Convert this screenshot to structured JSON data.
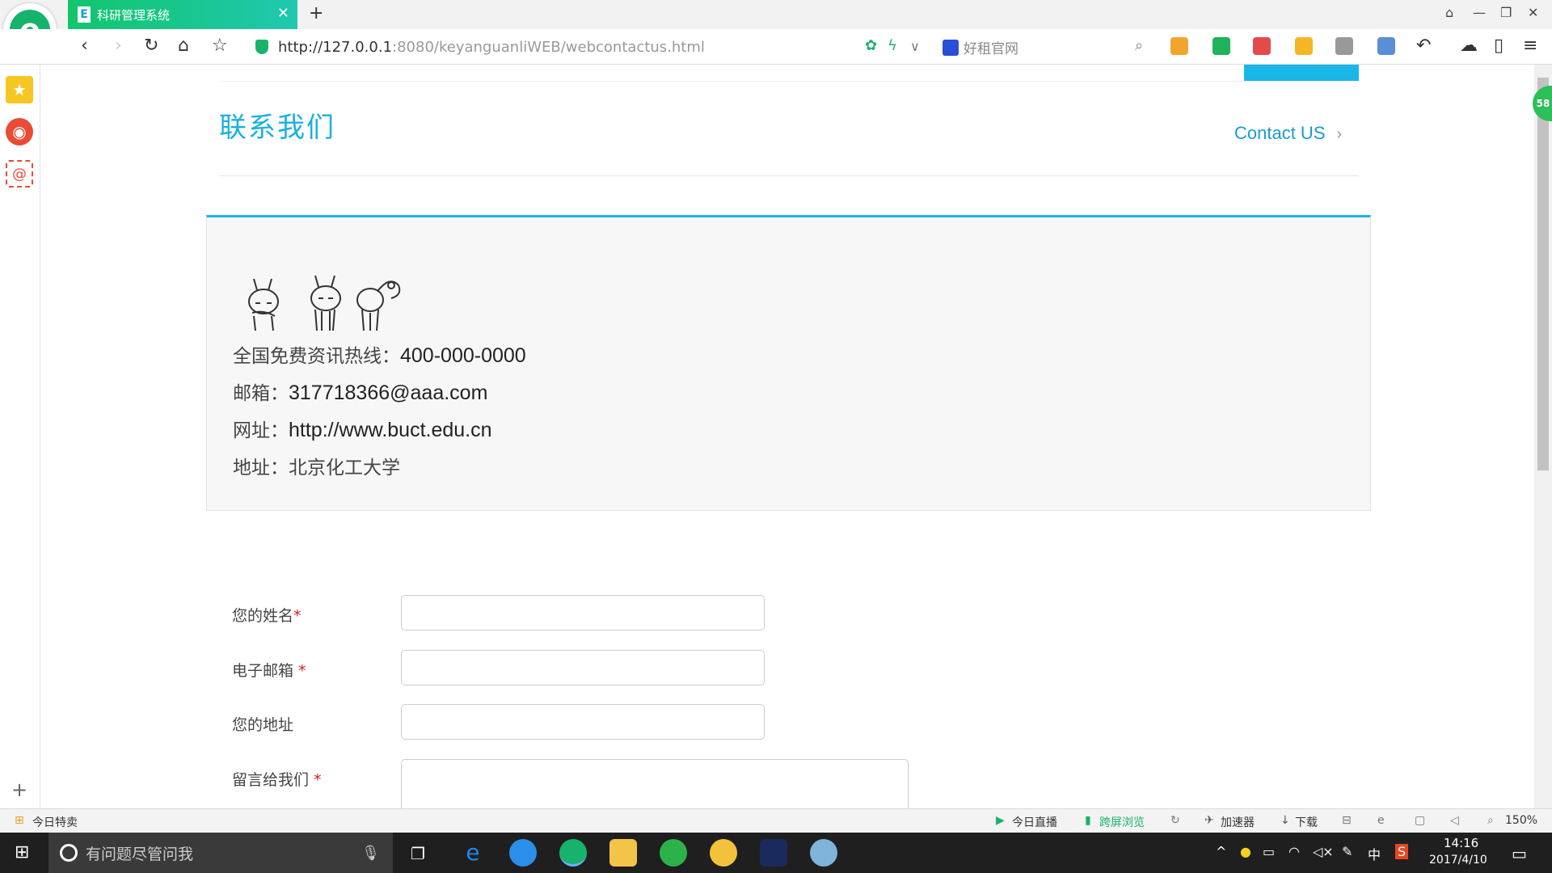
{
  "browser": {
    "tab_title": "科研管理系统",
    "tab_icon_letter": "E",
    "new_tab": "+",
    "url_host": "http://127.0.0.1",
    "url_rest": ":8080/keyanguanliWEB/webcontactus.html",
    "search_placeholder": "好租官网",
    "zoom": "150%"
  },
  "sidebar_badge": "58",
  "page": {
    "title": "联系我们",
    "contact_us": "Contact US",
    "chevron": "›",
    "info": [
      {
        "label": "全国免费资讯热线：",
        "value": "400-000-0000"
      },
      {
        "label": "邮箱：",
        "value": "317718366@aaa.com"
      },
      {
        "label": "网址：",
        "value": "http://www.buct.edu.cn"
      },
      {
        "label": "地址：",
        "value": "北京化工大学"
      }
    ],
    "form": {
      "name_label": "您的姓名",
      "email_label": "电子邮箱 ",
      "address_label": "您的地址",
      "message_label": "留言给我们 ",
      "required_mark": "*"
    }
  },
  "statusbar": {
    "today_sale": "今日特卖",
    "live": "今日直播",
    "cross_screen": "跨屏浏览",
    "accelerator": "加速器",
    "download": "下载",
    "zoom": "150%"
  },
  "taskbar": {
    "cortana_placeholder": "有问题尽管问我",
    "time": "14:16",
    "date": "2017/4/10",
    "ime": "中"
  },
  "colors": {
    "accent": "#18b7e8",
    "tab_gradient_start": "#12c56c",
    "tab_gradient_end": "#1fc8b0"
  }
}
